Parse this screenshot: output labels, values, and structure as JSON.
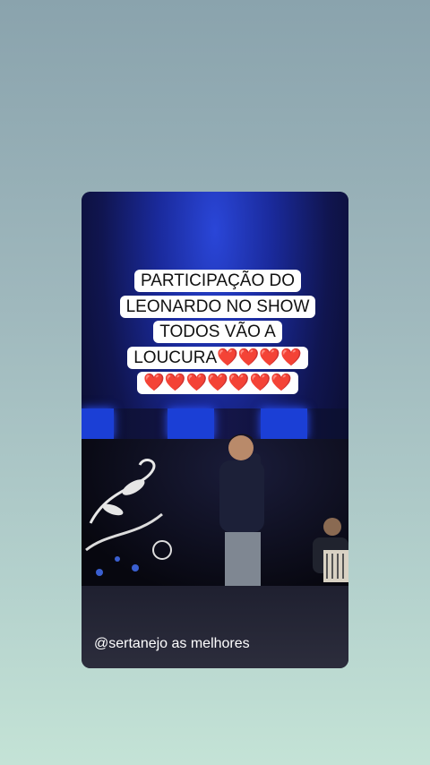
{
  "post": {
    "caption_lines": [
      "PARTICIPAÇÃO DO",
      "LEONARDO NO SHOW",
      "TODOS VÃO A",
      "LOUCURA❤️❤️❤️❤️",
      "❤️❤️❤️❤️❤️❤️❤️"
    ],
    "handle": "@sertanejo as melhores"
  },
  "colors": {
    "background_top": "#8aa3ad",
    "background_bottom": "#c4e3d6",
    "stage_blue": "#1b3fd6",
    "caption_bg": "#ffffff"
  },
  "icons": [
    "video-frame"
  ]
}
